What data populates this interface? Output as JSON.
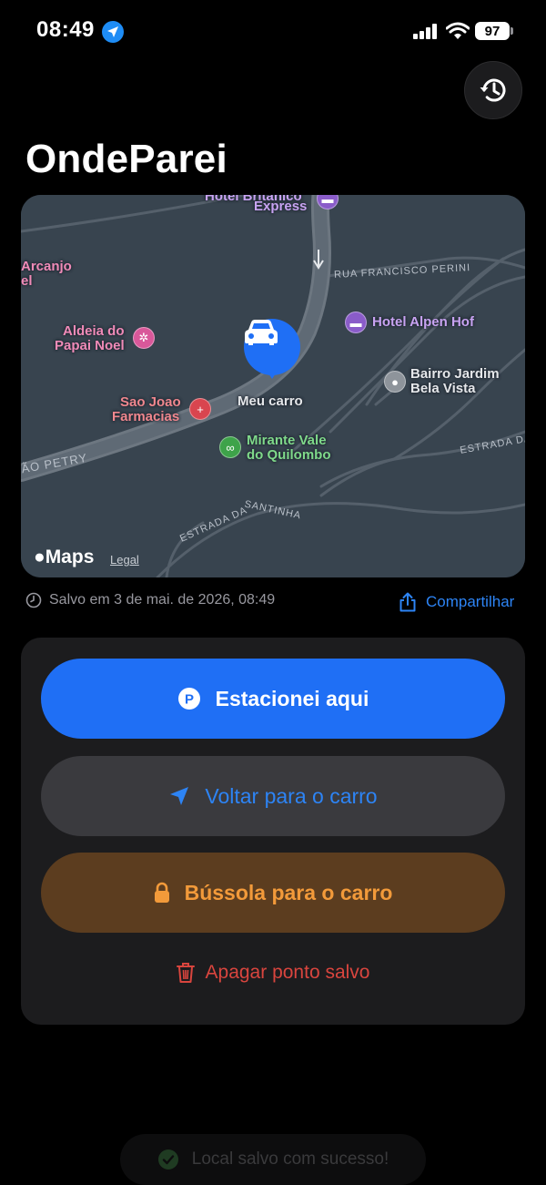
{
  "status_bar": {
    "time": "08:49",
    "battery": "97"
  },
  "app": {
    "title": "OndeParei"
  },
  "map": {
    "labels": {
      "hotel_express": "Express",
      "hotel_partial": "Hotel Britânico",
      "arcanjo_1": "Arcanjo",
      "arcanjo_2": "el",
      "aldeia_1": "Aldeia do",
      "aldeia_2": "Papai Noel",
      "hotel_alpen": "Hotel Alpen Hof",
      "bairro_1": "Bairro Jardim",
      "bairro_2": "Bela Vista",
      "sao_joao_1": "Sao Joao",
      "sao_joao_2": "Farmacias",
      "mirante_1": "Mirante Vale",
      "mirante_2": "do Quilombo",
      "car_label": "Meu carro"
    },
    "streets": {
      "rua_francisco": "RUA FRANCISCO PERINI",
      "petry": "ÃO PETRY",
      "estrada_da": "ESTRADA DA",
      "santinha": "ESTRADA DA SANTINHA"
    },
    "brand": "Maps",
    "legal": "Legal"
  },
  "saved": {
    "text": "Salvo em 3 de mai. de 2026, 08:49"
  },
  "share": {
    "label": "Compartilhar"
  },
  "actions": {
    "park": "Estacionei aqui",
    "back": "Voltar para o carro",
    "compass": "Bússola para o carro",
    "delete": "Apagar ponto salvo"
  },
  "toast": {
    "text": "Local salvo com sucesso!"
  },
  "colors": {
    "accent": "#1f6ff5",
    "orange": "#f29a3a",
    "danger": "#d9453e"
  }
}
